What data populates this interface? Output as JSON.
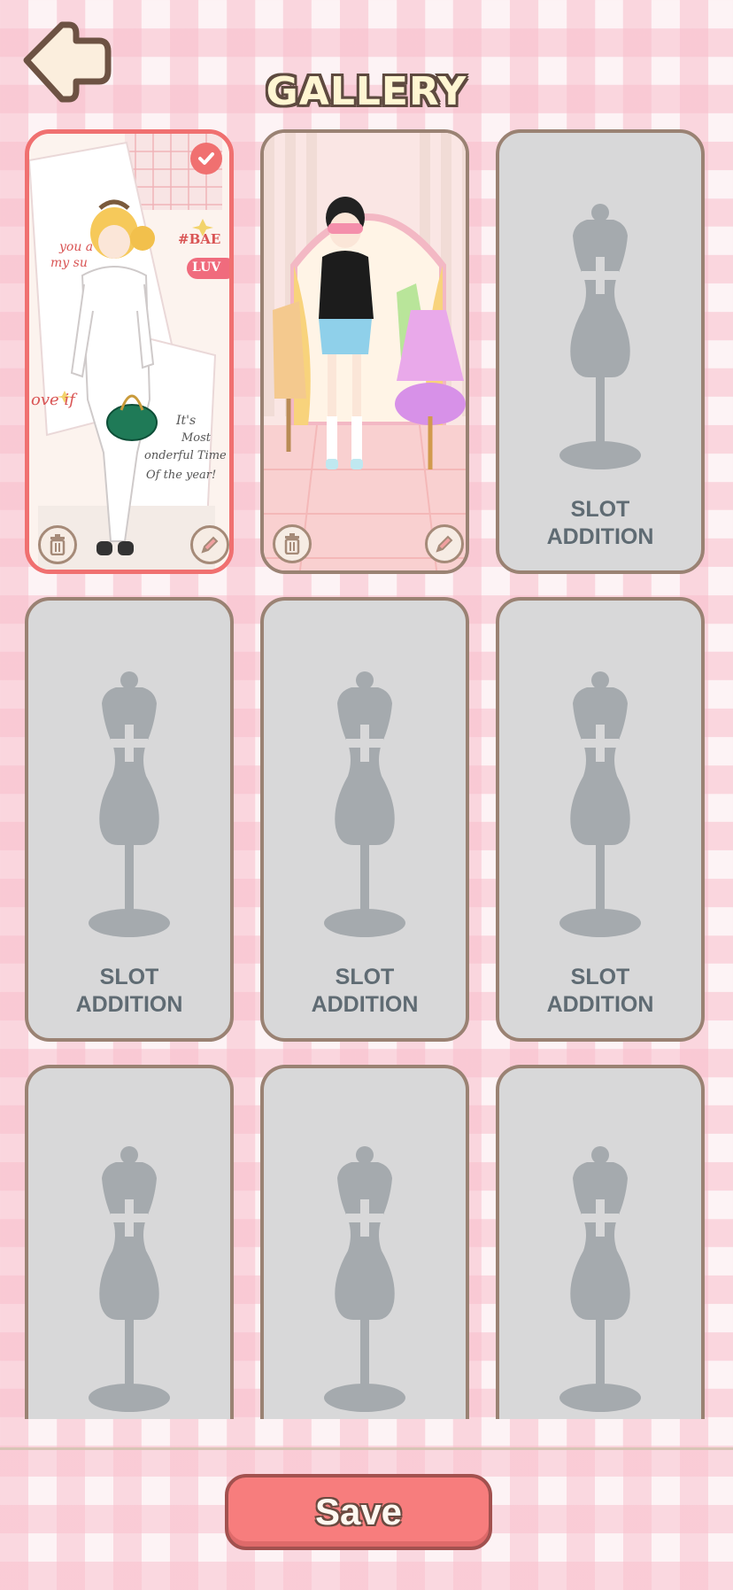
{
  "header": {
    "title": "GALLERY",
    "back_icon": "back-arrow-icon"
  },
  "gallery": {
    "saved_outfits": [
      {
        "selected": true,
        "scene_text": [
          "you a",
          "my su",
          "#BAE",
          "LUV",
          "ove if",
          "It's",
          "Most",
          "onderful Time",
          "Of the year!"
        ],
        "delete_icon": "trash-icon",
        "edit_icon": "pencil-icon",
        "check_icon": "checkmark-icon"
      },
      {
        "selected": false,
        "delete_icon": "trash-icon",
        "edit_icon": "pencil-icon"
      }
    ],
    "empty_slot_label": "SLOT\nADDITION",
    "empty_slot_icon": "mannequin-plus-icon"
  },
  "footer": {
    "save_label": "Save"
  },
  "colors": {
    "accent": "#f77d7d",
    "slot_gray": "#d8d8d9",
    "slot_border": "#9a8273",
    "mannequin": "#a5aaae"
  }
}
